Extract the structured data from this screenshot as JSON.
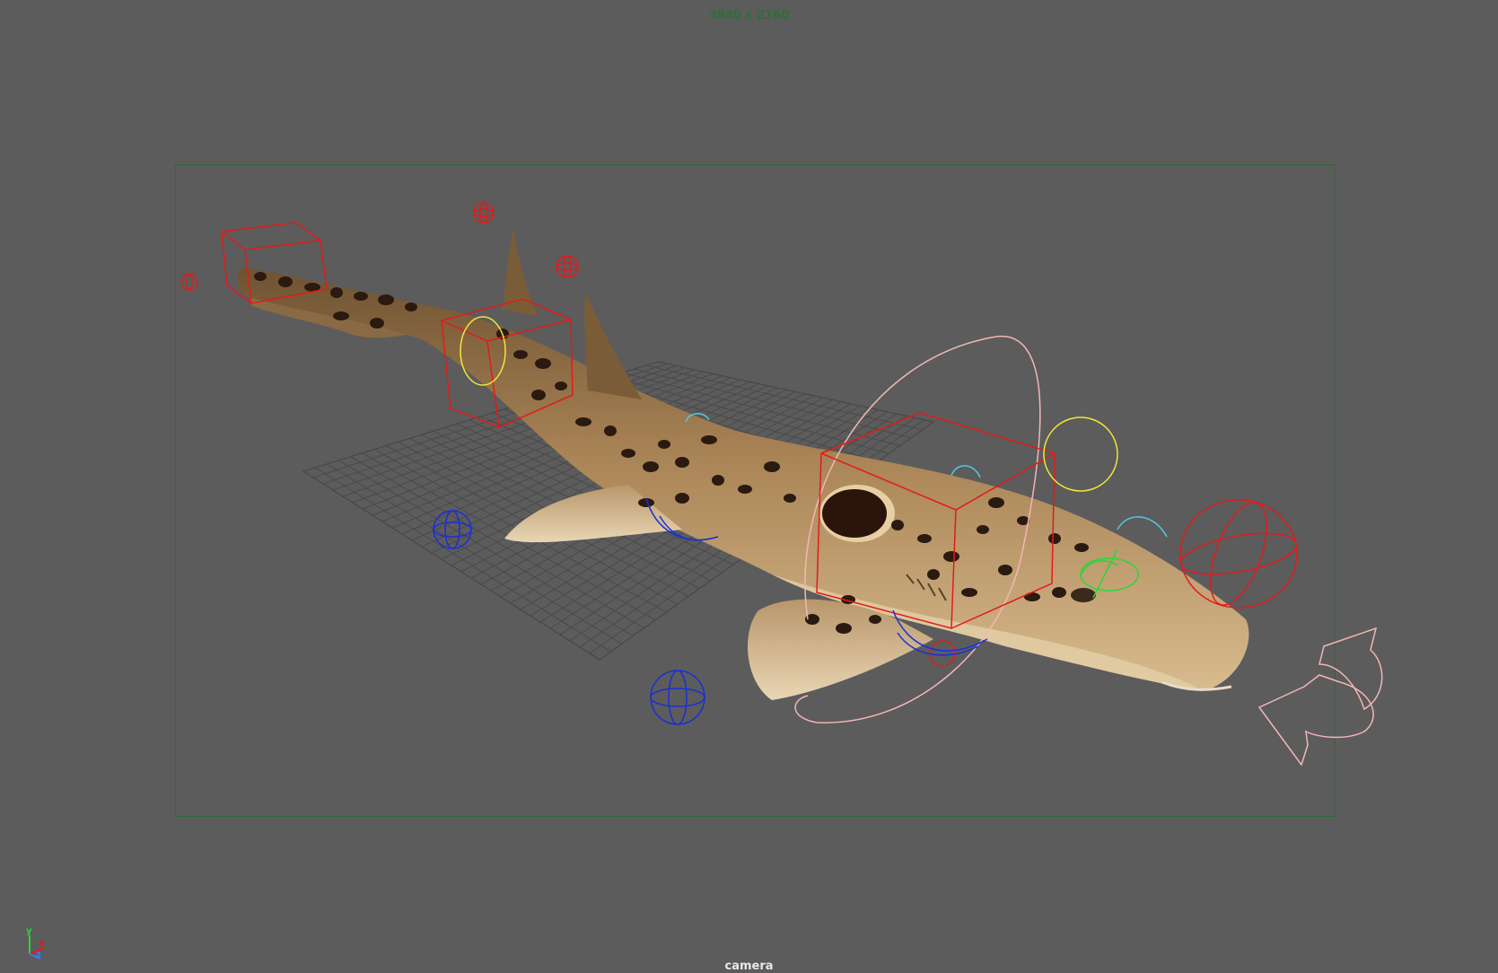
{
  "viewport": {
    "resolution_label": "3840 x 2160",
    "camera_label": "camera",
    "axis": {
      "y": "y",
      "x": "x",
      "z": "z"
    }
  },
  "colors": {
    "background": "#5c5c5c",
    "gate": "#2f6a36",
    "control_red": "#e21b1b",
    "control_blue": "#1a2fd6",
    "control_cyan": "#54c8e8",
    "control_yellow": "#f0e63a",
    "control_green": "#2ad63a",
    "control_pink": "#f4b6b6",
    "shark_skin": "#a98456",
    "shark_spots": "#2a1a10"
  }
}
